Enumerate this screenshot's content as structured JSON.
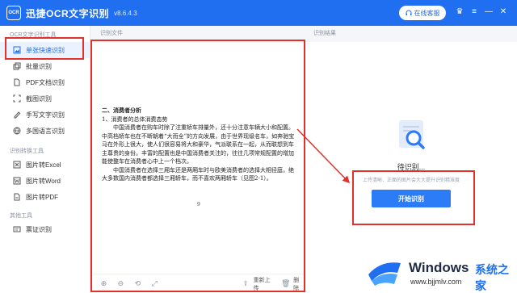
{
  "titlebar": {
    "logo_text": "OCR",
    "title": "迅捷OCR文字识别",
    "version": "v8.6.4.3",
    "online_btn": "在线客服"
  },
  "sidebar": {
    "section1": "OCR文字识别工具",
    "items1": [
      {
        "label": "单张快速识别",
        "icon": "image-icon"
      },
      {
        "label": "批量识别",
        "icon": "batch-icon"
      },
      {
        "label": "PDF文档识别",
        "icon": "pdf-icon"
      },
      {
        "label": "截图识别",
        "icon": "screenshot-icon"
      },
      {
        "label": "手写文字识别",
        "icon": "pen-icon"
      },
      {
        "label": "多国语言识别",
        "icon": "globe-icon"
      }
    ],
    "section2": "识别转换工具",
    "items2": [
      {
        "label": "图片转Excel",
        "icon": "excel-icon"
      },
      {
        "label": "图片转Word",
        "icon": "word-icon"
      },
      {
        "label": "图片转PDF",
        "icon": "pdf2-icon"
      }
    ],
    "section3": "其他工具",
    "items3": [
      {
        "label": "票证识别",
        "icon": "ticket-icon"
      }
    ]
  },
  "doc_panel": {
    "header": "识别文件",
    "heading": "二、消费者分析",
    "sub": "1、消费者的总体消费态势",
    "para1": "中国消费者在购车时除了注重轿车排量外，还十分注意车辆大小和配置。中高档轿车也在不断朝着“大而全”的方向发展，由于世界现级名车，如奔驰宝马在外形上很大，使人们很容易将大和豪华，气派联系在一起，从而联想到车主尊贵的身份。丰富的配置也是中国消费者关注的，往往几项常规配置的增加能使整车在消费者心中上一个档次。",
    "para2": "中国消费者在选择三厢车还是两厢车时与欧美消费者的选择大相径庭，绝大多数国内消费者都选择三厢轿车，而不喜欢两厢轿车（见图2-1）。",
    "page_no": "9",
    "toolbar": {
      "reupload": "重新上传",
      "delete": "删除"
    }
  },
  "result_panel": {
    "header": "识别结果",
    "wait": "待识别...",
    "hint": "上传清晰、正面的图片会大大提升识别精准度",
    "start": "开始识别"
  },
  "watermark": {
    "windows": "Windows",
    "cn": "系统之家",
    "url": "www.bjjmlv.com"
  },
  "colors": {
    "brand": "#1f6ff0",
    "highlight": "#e0322b"
  }
}
